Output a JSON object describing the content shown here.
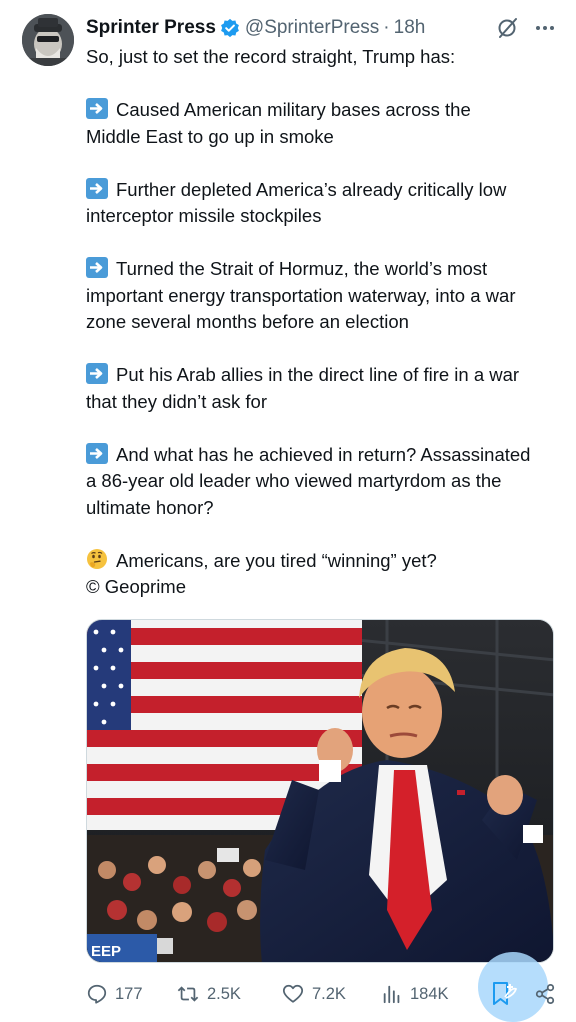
{
  "author": {
    "name": "Sprinter Press",
    "handle": "@SprinterPress",
    "separator": "·",
    "time": "18h"
  },
  "colors": {
    "accent": "#1d9bf0",
    "muted": "#536471",
    "text": "#0f1419",
    "emoji_blue": "#4a9bd8"
  },
  "icons": {
    "verified": "verified-badge-icon",
    "grok": "grok-icon",
    "more": "more-options-icon",
    "arrow": "right-arrow-emoji-icon",
    "thinking": "thinking-face-emoji-icon"
  },
  "tweet": {
    "intro": "So, just to set the record straight, Trump has:",
    "points": [
      {
        "lines": [
          "Caused American military bases across the",
          "Middle East to go up in smoke"
        ]
      },
      {
        "lines": [
          "Further depleted America’s already critically low",
          "interceptor missile stockpiles"
        ]
      },
      {
        "lines": [
          "Turned the Strait of Hormuz, the world’s most",
          "important energy transportation waterway, into a war",
          "zone several months before an election"
        ]
      },
      {
        "lines": [
          "Put his Arab allies in the direct line of fire in a war",
          "that they didn’t ask for"
        ]
      },
      {
        "lines": [
          "And what has he achieved in return? Assassinated",
          "a 86-year old leader who viewed martyrdom as the",
          "ultimate honor?"
        ]
      }
    ],
    "closing_question": "Americans, are you tired “winning” yet?",
    "credit": "© Geoprime"
  },
  "media": {
    "banner_text": "EEP"
  },
  "actions": {
    "replies": "177",
    "reposts": "2.5K",
    "likes": "7.2K",
    "views": "184K"
  }
}
